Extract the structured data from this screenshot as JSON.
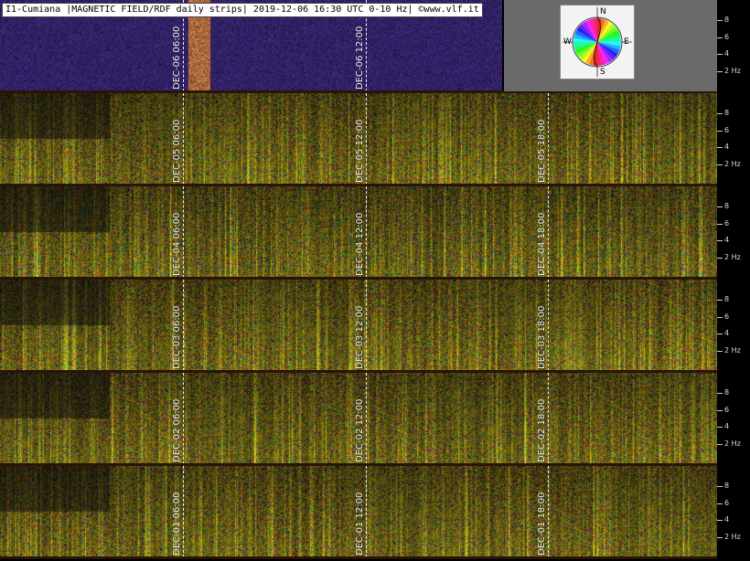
{
  "title": "I1-Cumiana |MAGNETIC FIELD/RDF daily strips| 2019-12-06 16:30 UTC 0-10 Hz| ©www.vlf.it",
  "compass": {
    "north": "N",
    "south": "S",
    "east": "E",
    "west": "W"
  },
  "colors": {
    "background": "#000000",
    "axis_text": "#d8d8d8",
    "marker": "#f2f2f2",
    "grey_block": "#6a6a6a"
  },
  "chart_data": {
    "type": "heatmap",
    "title": "I1-Cumiana |MAGNETIC FIELD/RDF daily strips| 2019-12-06 16:30 UTC 0-10 Hz| ©www.vlf.it",
    "y_axis": {
      "unit": "Hz",
      "range": [
        0,
        10
      ],
      "ticks": [
        {
          "value": 8,
          "label": "8"
        },
        {
          "value": 6,
          "label": "6"
        },
        {
          "value": 4,
          "label": "4"
        },
        {
          "value": 2,
          "label": "2 Hz"
        }
      ]
    },
    "strips": [
      {
        "day": "DEC-06",
        "markers": [
          {
            "time": "06:00",
            "label": "DEC-06 06:00"
          },
          {
            "time": "12:00",
            "label": "DEC-06 12:00"
          }
        ],
        "data_end": "16:30",
        "palette": "quiet-blue"
      },
      {
        "day": "DEC-05",
        "markers": [
          {
            "time": "06:00",
            "label": "DEC-05 06:00"
          },
          {
            "time": "12:00",
            "label": "DEC-05 12:00"
          },
          {
            "time": "18:00",
            "label": "DEC-05 18:00"
          }
        ],
        "palette": "active"
      },
      {
        "day": "DEC-04",
        "markers": [
          {
            "time": "06:00",
            "label": "DEC-04 06:00"
          },
          {
            "time": "12:00",
            "label": "DEC-04 12:00"
          },
          {
            "time": "18:00",
            "label": "DEC-04 18:00"
          }
        ],
        "palette": "active"
      },
      {
        "day": "DEC-03",
        "markers": [
          {
            "time": "06:00",
            "label": "DEC-03 06:00"
          },
          {
            "time": "12:00",
            "label": "DEC-03 12:00"
          },
          {
            "time": "18:00",
            "label": "DEC-03 18:00"
          }
        ],
        "palette": "active"
      },
      {
        "day": "DEC-02",
        "markers": [
          {
            "time": "06:00",
            "label": "DEC-02 06:00"
          },
          {
            "time": "12:00",
            "label": "DEC-02 12:00"
          },
          {
            "time": "18:00",
            "label": "DEC-02 18:00"
          }
        ],
        "palette": "active"
      },
      {
        "day": "DEC-01",
        "markers": [
          {
            "time": "06:00",
            "label": "DEC-01 06:00"
          },
          {
            "time": "12:00",
            "label": "DEC-01 12:00"
          },
          {
            "time": "18:00",
            "label": "DEC-01 18:00"
          }
        ],
        "palette": "active"
      }
    ]
  }
}
